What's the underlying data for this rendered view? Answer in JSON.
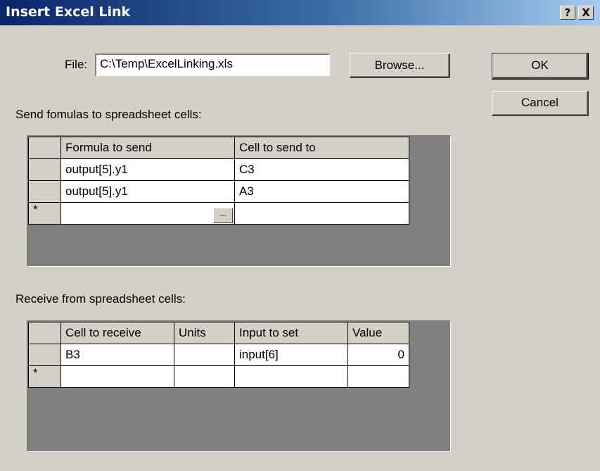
{
  "window": {
    "title": "Insert Excel Link",
    "help_label": "?",
    "close_label": "X"
  },
  "file": {
    "label": "File:",
    "value": "C:\\Temp\\ExcelLinking.xls",
    "browse_label": "Browse..."
  },
  "buttons": {
    "ok_label": "OK",
    "cancel_label": "Cancel"
  },
  "send": {
    "label": "Send  fomulas to spreadsheet cells:",
    "columns": [
      "Formula to send",
      "Cell to send to"
    ],
    "rows": [
      [
        "output[5].y1",
        "C3"
      ],
      [
        "output[5].y1",
        "A3"
      ]
    ],
    "new_row_marker": "*",
    "ellipsis_label": "..."
  },
  "receive": {
    "label": "Receive from spreadsheet cells:",
    "columns": [
      "Cell to receive",
      "Units",
      "Input to set",
      "Value"
    ],
    "rows": [
      [
        "B3",
        "",
        "input[6]",
        "0"
      ]
    ],
    "new_row_marker": "*"
  }
}
